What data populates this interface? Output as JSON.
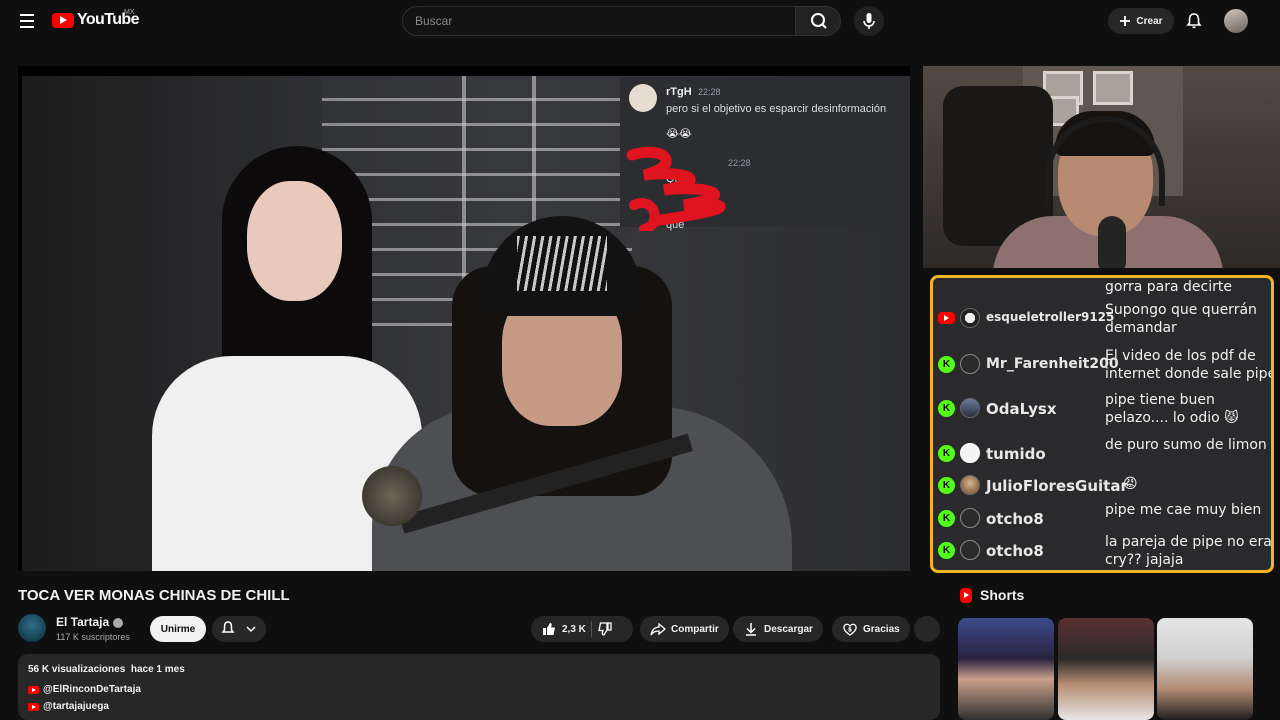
{
  "header": {
    "logo_text": "YouTube",
    "country": "MX",
    "search_placeholder": "Buscar",
    "create_label": "Crear"
  },
  "video_overlay_chat": {
    "messages": [
      {
        "user": "rTgH",
        "time": "22:28",
        "text": "pero si el objetivo es esparcir desinformación",
        "emoji": "😭😭"
      },
      {
        "time": "22:28",
        "text": "Que"
      },
      {
        "text": "que"
      }
    ]
  },
  "live_chat": {
    "rows": [
      {
        "platform": "",
        "user": "",
        "message": "gorra para decirte",
        "avatar": ""
      },
      {
        "platform": "youtube",
        "user": "esqueletroller9125",
        "message": "Supongo que querrán demandar",
        "avatar": "skull-avatar"
      },
      {
        "platform": "kick",
        "user": "Mr_Farenheit200",
        "message": "El video de los pdf de internet donde sale pipe",
        "avatar": "default-avatar"
      },
      {
        "platform": "kick",
        "user": "OdaLysx",
        "message": "pipe tiene buen pelazo.... lo odio 😾",
        "avatar": "custom-avatar"
      },
      {
        "platform": "kick",
        "user": "tumido",
        "message": "de puro sumo de limon",
        "avatar": "mask-avatar"
      },
      {
        "platform": "kick",
        "user": "JulioFloresGuitar",
        "message": "😡",
        "avatar": "photo-avatar"
      },
      {
        "platform": "kick",
        "user": "otcho8",
        "message": "pipe me cae muy bien",
        "avatar": "default-avatar"
      },
      {
        "platform": "kick",
        "user": "otcho8",
        "message": "la pareja de pipe no era cry?? jajaja",
        "avatar": "default-avatar"
      }
    ],
    "border_color": "#f2b425",
    "kick_color": "#53fc18"
  },
  "video": {
    "title": "TOCA VER MONAS CHINAS DE CHILL",
    "channel": "El Tartaja",
    "subscribers": "117 K suscriptores",
    "join_label": "Unirme",
    "likes": "2,3 K",
    "share_label": "Compartir",
    "download_label": "Descargar",
    "thanks_label": "Gracias"
  },
  "description": {
    "views": "56 K visualizaciones",
    "date": "hace 1 mes",
    "links": [
      "@ElRinconDeTartaja",
      "@tartajajuega"
    ]
  },
  "shorts": {
    "title": "Shorts"
  }
}
